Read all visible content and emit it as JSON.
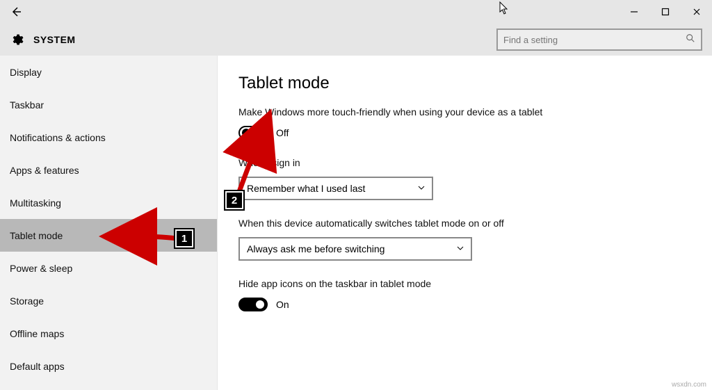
{
  "header": {
    "title": "SYSTEM"
  },
  "search": {
    "placeholder": "Find a setting"
  },
  "sidebar": {
    "items": [
      {
        "label": "Display"
      },
      {
        "label": "Taskbar"
      },
      {
        "label": "Notifications & actions"
      },
      {
        "label": "Apps & features"
      },
      {
        "label": "Multitasking"
      },
      {
        "label": "Tablet mode"
      },
      {
        "label": "Power & sleep"
      },
      {
        "label": "Storage"
      },
      {
        "label": "Offline maps"
      },
      {
        "label": "Default apps"
      }
    ],
    "selected_index": 5
  },
  "content": {
    "page_title": "Tablet mode",
    "touch_label": "Make Windows more touch-friendly when using your device as a tablet",
    "touch_toggle_text": "Off",
    "signin_label": "When I sign in",
    "signin_value": "Remember what I used last",
    "auto_label": "When this device automatically switches tablet mode on or off",
    "auto_value": "Always ask me before switching",
    "hide_label": "Hide app icons on the taskbar in tablet mode",
    "hide_toggle_text": "On"
  },
  "annotations": {
    "marker1": "1",
    "marker2": "2"
  },
  "watermark": "wsxdn.com"
}
